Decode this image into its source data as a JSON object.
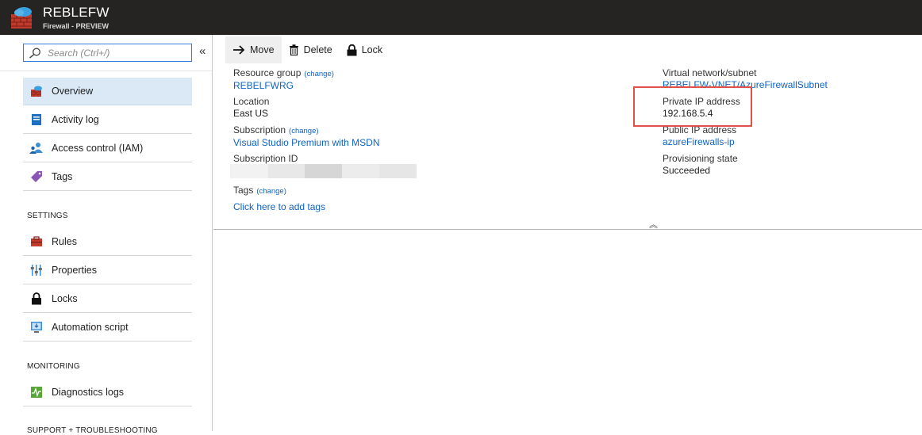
{
  "header": {
    "title": "REBLEFW",
    "subtitle": "Firewall - PREVIEW"
  },
  "sidebar": {
    "search_placeholder": "Search (Ctrl+/)",
    "collapse_label": "«",
    "items": [
      {
        "label": "Overview",
        "icon": "firewall-icon",
        "active": true
      },
      {
        "label": "Activity log",
        "icon": "activity-log-icon"
      },
      {
        "label": "Access control (IAM)",
        "icon": "access-control-icon"
      },
      {
        "label": "Tags",
        "icon": "tag-icon"
      }
    ],
    "settings_header": "SETTINGS",
    "settings_items": [
      {
        "label": "Rules",
        "icon": "rules-icon"
      },
      {
        "label": "Properties",
        "icon": "properties-icon"
      },
      {
        "label": "Locks",
        "icon": "lock-icon"
      },
      {
        "label": "Automation script",
        "icon": "automation-script-icon"
      }
    ],
    "monitoring_header": "MONITORING",
    "monitoring_items": [
      {
        "label": "Diagnostics logs",
        "icon": "diagnostics-icon"
      }
    ],
    "support_header": "SUPPORT + TROUBLESHOOTING"
  },
  "toolbar": {
    "move_label": "Move",
    "delete_label": "Delete",
    "lock_label": "Lock"
  },
  "essentials": {
    "resource_group_label": "Resource group",
    "change_label": "(change)",
    "resource_group_value": "REBELFWRG",
    "location_label": "Location",
    "location_value": "East US",
    "subscription_label": "Subscription",
    "subscription_value": "Visual Studio Premium with MSDN",
    "subscription_id_label": "Subscription ID",
    "tags_label": "Tags",
    "tags_add_link": "Click here to add tags",
    "vnet_label": "Virtual network/subnet",
    "vnet_value": "REBELFW-VNET/AzureFirewallSubnet",
    "private_ip_label": "Private IP address",
    "private_ip_value": "192.168.5.4",
    "public_ip_label": "Public IP address",
    "public_ip_value": "azureFirewalls-ip",
    "provisioning_label": "Provisioning state",
    "provisioning_value": "Succeeded",
    "collapse_chevron": "︽"
  },
  "colors": {
    "titlebar": "#252423",
    "accent_link": "#0e63c7",
    "active_item": "#dbe9f7",
    "highlight": "#e2504a"
  }
}
